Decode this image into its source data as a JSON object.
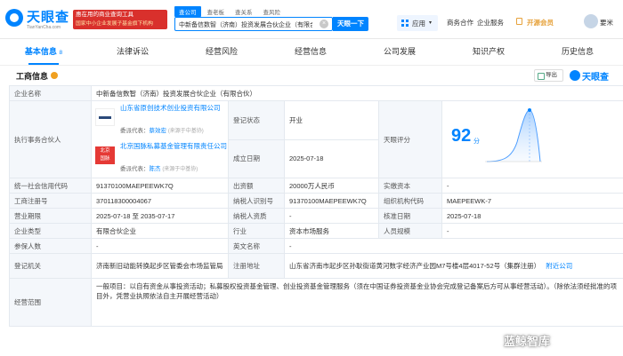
{
  "header": {
    "logo_text": "天眼查",
    "logo_url": "TianYanCha.com",
    "promo_line1": "惠在用的商业查询工具",
    "promo_line2": "国家中小企业发展子基金旗下机构",
    "search_tabs": [
      "查公司",
      "查老板",
      "查关系",
      "查风险"
    ],
    "search_value": "中新备信数智（济南）投资发展合伙企业（有限合伙）",
    "search_button": "天眼一下",
    "app_label": "应用",
    "nav_items": [
      "商务合作",
      "企业服务"
    ],
    "vip_label": "开源会员",
    "user_name": "要米"
  },
  "tabs": [
    {
      "label": "基本信息",
      "count": "8",
      "active": true
    },
    {
      "label": "法律诉讼",
      "count": "",
      "active": false
    },
    {
      "label": "经营风险",
      "count": "",
      "active": false
    },
    {
      "label": "经营信息",
      "count": "",
      "active": false
    },
    {
      "label": "公司发展",
      "count": "",
      "active": false
    },
    {
      "label": "知识产权",
      "count": "",
      "active": false
    },
    {
      "label": "历史信息",
      "count": "",
      "active": false
    }
  ],
  "section": {
    "title": "工商信息",
    "export_label": "导出",
    "brand": "天眼查"
  },
  "info": {
    "company_name_label": "企业名称",
    "company_name": "中新备信数智（济南）投资发展合伙企业（有限合伙）",
    "partner_label": "执行事务合伙人",
    "partners": [
      {
        "name": "山东省原创技术创业投资有限公司",
        "rep_label": "委派代表：",
        "rep_name": "蔡效宏",
        "rep_note": "(来源于中基协)",
        "logo": "LUCK"
      },
      {
        "name": "北京国脉私募基金管理有限责任公司",
        "rep_label": "委派代表：",
        "rep_name": "陈杰",
        "rep_note": "(来源于中基协)",
        "logo_line1": "北京",
        "logo_line2": "国脉"
      }
    ],
    "status_label": "登记状态",
    "status": "开业",
    "score_label": "天眼评分",
    "score": "92",
    "score_unit": "分",
    "founded_label": "成立日期",
    "founded": "2025-07-18",
    "credit_code_label": "统一社会信用代码",
    "credit_code": "91370100MAEPEEWK7Q",
    "capital_label": "出资额",
    "capital": "20000万人民币",
    "paid_capital_label": "实缴资本",
    "paid_capital": "-",
    "reg_no_label": "工商注册号",
    "reg_no": "370118300004067",
    "taxpayer_label": "纳税人识别号",
    "taxpayer": "91370100MAEPEEWK7Q",
    "org_code_label": "组织机构代码",
    "org_code": "MAEPEEWK-7",
    "term_label": "营业期限",
    "term": "2025-07-18 至 2035-07-17",
    "tax_quality_label": "纳税人资质",
    "tax_quality": "-",
    "approval_label": "核准日期",
    "approval": "2025-07-18",
    "type_label": "企业类型",
    "type": "有限合伙企业",
    "industry_label": "行业",
    "industry": "资本市场服务",
    "staff_label": "人员规模",
    "staff": "-",
    "insured_label": "参保人数",
    "insured": "-",
    "former_name_label": "英文名称",
    "former_name": "-",
    "authority_label": "登记机关",
    "authority": "济南新旧动能转换起步区管委会市场监管局",
    "address_label": "注册地址",
    "address": "山东省济南市起步区孙耿街道黄河数字经济产业园M7号楼4层4017-52号（集群注册）",
    "nearby_label": "附近公司",
    "scope_label": "经营范围",
    "scope": "一般项目：以自有资金从事投资活动；私募股权投资基金管理、创业投资基金管理服务（须在中国证券投资基金业协会完成登记备案后方可从事经营活动）。（除依法须经批准的项目外，凭营业执照依法自主开展经营活动）"
  },
  "watermark": "蓝鲸智库",
  "colors": {
    "accent": "#0084ff",
    "promo": "#d9302c",
    "vip": "#e6a23c",
    "status": "#2ea043"
  }
}
